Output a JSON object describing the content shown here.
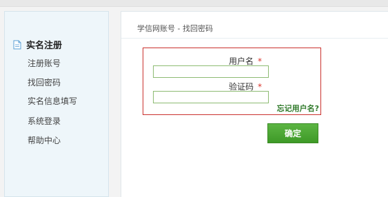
{
  "sidebar": {
    "heading": "实名注册",
    "items": [
      {
        "label": "注册账号"
      },
      {
        "label": "找回密码"
      },
      {
        "label": "实名信息填写"
      },
      {
        "label": "系统登录"
      },
      {
        "label": "帮助中心"
      }
    ]
  },
  "main": {
    "breadcrumb": "学信网账号 - 找回密码",
    "form": {
      "username_label": "用户名",
      "username_value": "",
      "captcha_label": "验证码",
      "captcha_value": "",
      "required_mark": "*",
      "forgot_username": "忘记用户名?",
      "confirm_label": "确定"
    }
  },
  "colors": {
    "form_border": "#c9302c",
    "required": "#d9342b",
    "button": "#4aa832",
    "link": "#2f7a2a"
  },
  "icons": {
    "sidebar_heading": "document-icon"
  }
}
